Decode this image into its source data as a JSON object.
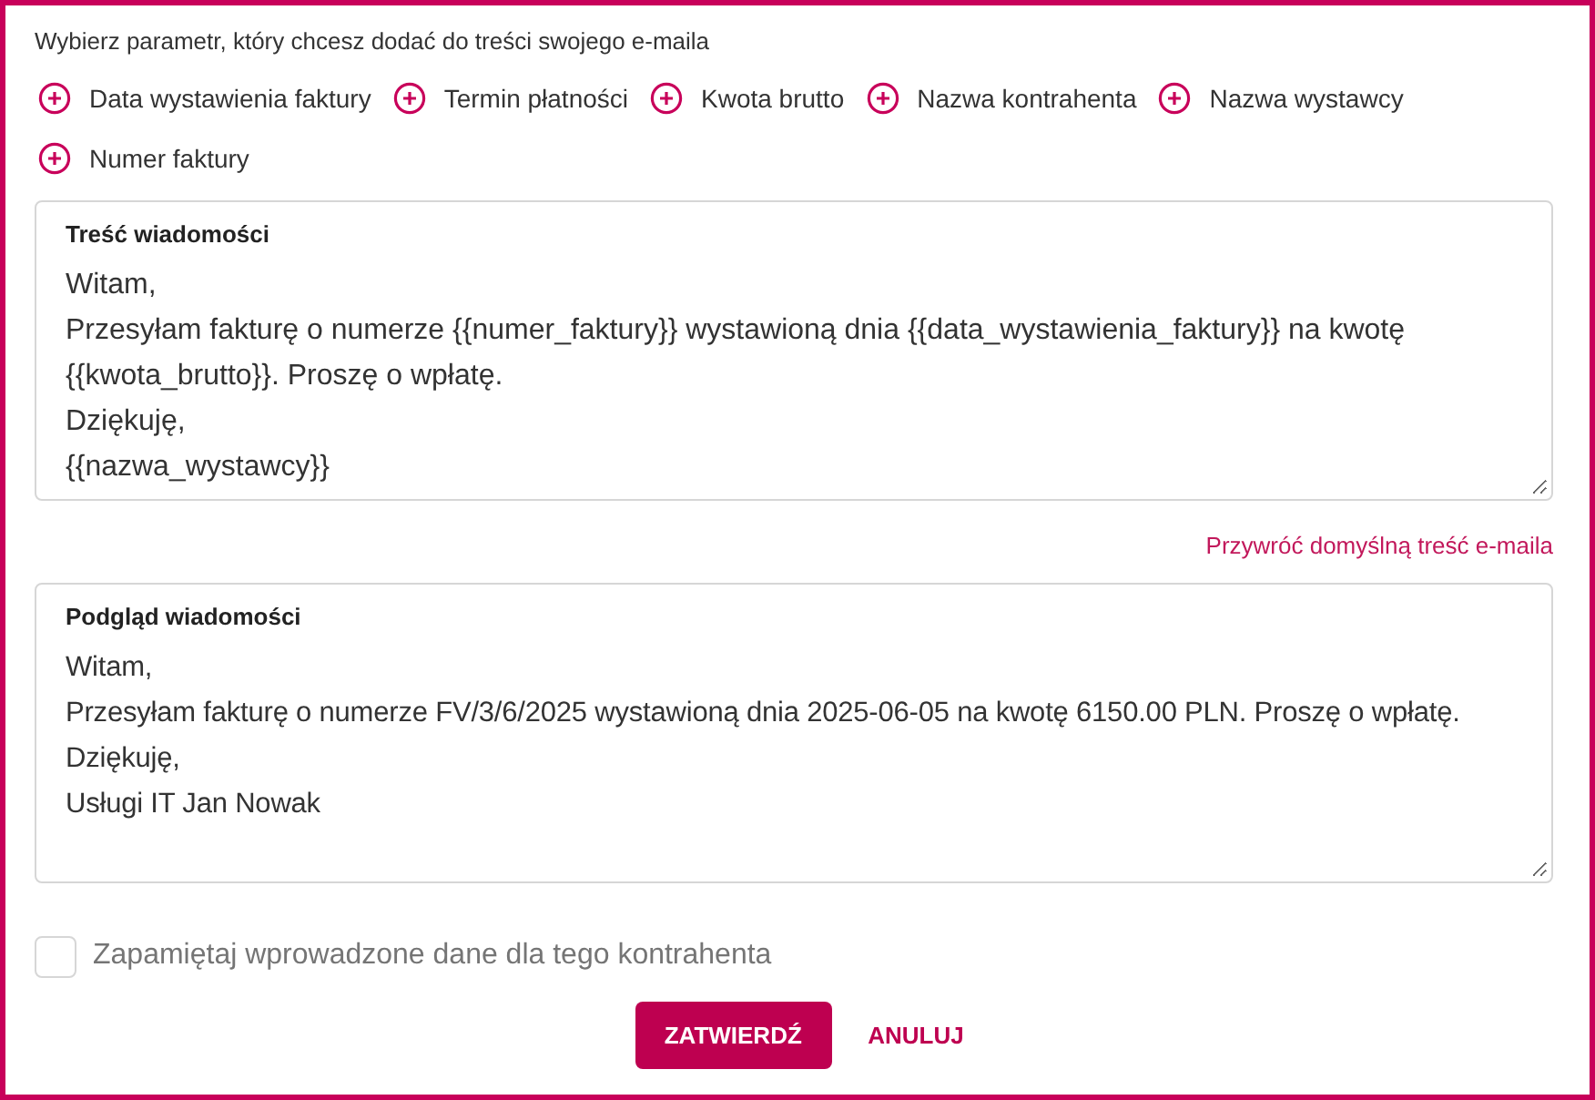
{
  "instruction": "Wybierz parametr, który chcesz dodać do treści swojego e-maila",
  "parameters": [
    "Data wystawienia faktury",
    "Termin płatności",
    "Kwota brutto",
    "Nazwa kontrahenta",
    "Nazwa wystawcy",
    "Numer faktury"
  ],
  "message": {
    "label": "Treść wiadomości",
    "lines": [
      "Witam,",
      "Przesyłam fakturę o numerze {{numer_faktury}} wystawioną dnia {{data_wystawienia_faktury}} na kwotę {{kwota_brutto}}. Proszę o wpłatę.",
      "Dziękuję,",
      "{{nazwa_wystawcy}}"
    ]
  },
  "restore_link": "Przywróć domyślną treść e-maila",
  "preview": {
    "label": "Podgląd wiadomości",
    "lines": [
      "Witam,",
      "Przesyłam fakturę o numerze FV/3/6/2025 wystawioną dnia 2025-06-05 na kwotę 6150.00 PLN. Proszę o wpłatę.",
      "Dziękuję,",
      "Usługi IT Jan Nowak"
    ]
  },
  "remember": {
    "label": "Zapamiętaj wprowadzone dane dla tego kontrahenta",
    "checked": false
  },
  "buttons": {
    "confirm": "ZATWIERDŹ",
    "cancel": "ANULUJ"
  }
}
